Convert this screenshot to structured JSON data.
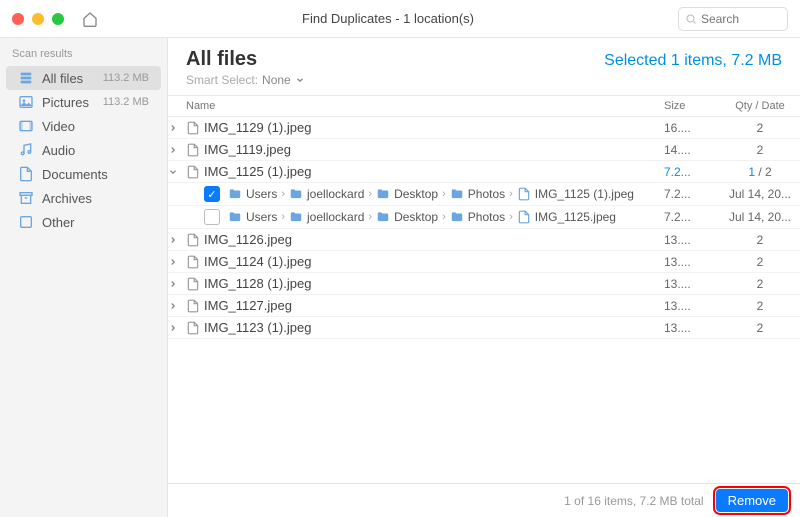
{
  "titlebar": {
    "title": "Find Duplicates - 1 location(s)",
    "search_placeholder": "Search"
  },
  "sidebar": {
    "header": "Scan results",
    "items": [
      {
        "label": "All files",
        "size": "113.2 MB",
        "icon": "stack-icon"
      },
      {
        "label": "Pictures",
        "size": "113.2 MB",
        "icon": "picture-icon"
      },
      {
        "label": "Video",
        "size": "",
        "icon": "video-icon"
      },
      {
        "label": "Audio",
        "size": "",
        "icon": "audio-icon"
      },
      {
        "label": "Documents",
        "size": "",
        "icon": "document-icon"
      },
      {
        "label": "Archives",
        "size": "",
        "icon": "archive-icon"
      },
      {
        "label": "Other",
        "size": "",
        "icon": "other-icon"
      }
    ]
  },
  "header": {
    "title": "All files",
    "selected": "Selected 1 items, 7.2 MB",
    "smart_label": "Smart Select:",
    "smart_value": "None"
  },
  "columns": {
    "name": "Name",
    "size": "Size",
    "qty": "Qty / Date"
  },
  "rows": [
    {
      "expanded": false,
      "name": "IMG_1129 (1).jpeg",
      "size": "16....",
      "qty": "2"
    },
    {
      "expanded": false,
      "name": "IMG_1119.jpeg",
      "size": "14....",
      "qty": "2"
    },
    {
      "expanded": true,
      "selected": true,
      "name": "IMG_1125 (1).jpeg",
      "size": "7.2...",
      "qty_sel": "1",
      "qty_total": "2",
      "paths": [
        {
          "checked": true,
          "segs": [
            "Users",
            "joellockard",
            "Desktop",
            "Photos",
            "IMG_1125 (1).jpeg"
          ],
          "size": "7.2...",
          "date": "Jul 14, 20..."
        },
        {
          "checked": false,
          "segs": [
            "Users",
            "joellockard",
            "Desktop",
            "Photos",
            "IMG_1125.jpeg"
          ],
          "size": "7.2...",
          "date": "Jul 14, 20..."
        }
      ]
    },
    {
      "expanded": false,
      "name": "IMG_1126.jpeg",
      "size": "13....",
      "qty": "2"
    },
    {
      "expanded": false,
      "name": "IMG_1124 (1).jpeg",
      "size": "13....",
      "qty": "2"
    },
    {
      "expanded": false,
      "name": "IMG_1128 (1).jpeg",
      "size": "13....",
      "qty": "2"
    },
    {
      "expanded": false,
      "name": "IMG_1127.jpeg",
      "size": "13....",
      "qty": "2"
    },
    {
      "expanded": false,
      "name": "IMG_1123 (1).jpeg",
      "size": "13....",
      "qty": "2"
    }
  ],
  "footer": {
    "summary": "1 of 16 items, 7.2 MB total",
    "remove_label": "Remove"
  }
}
